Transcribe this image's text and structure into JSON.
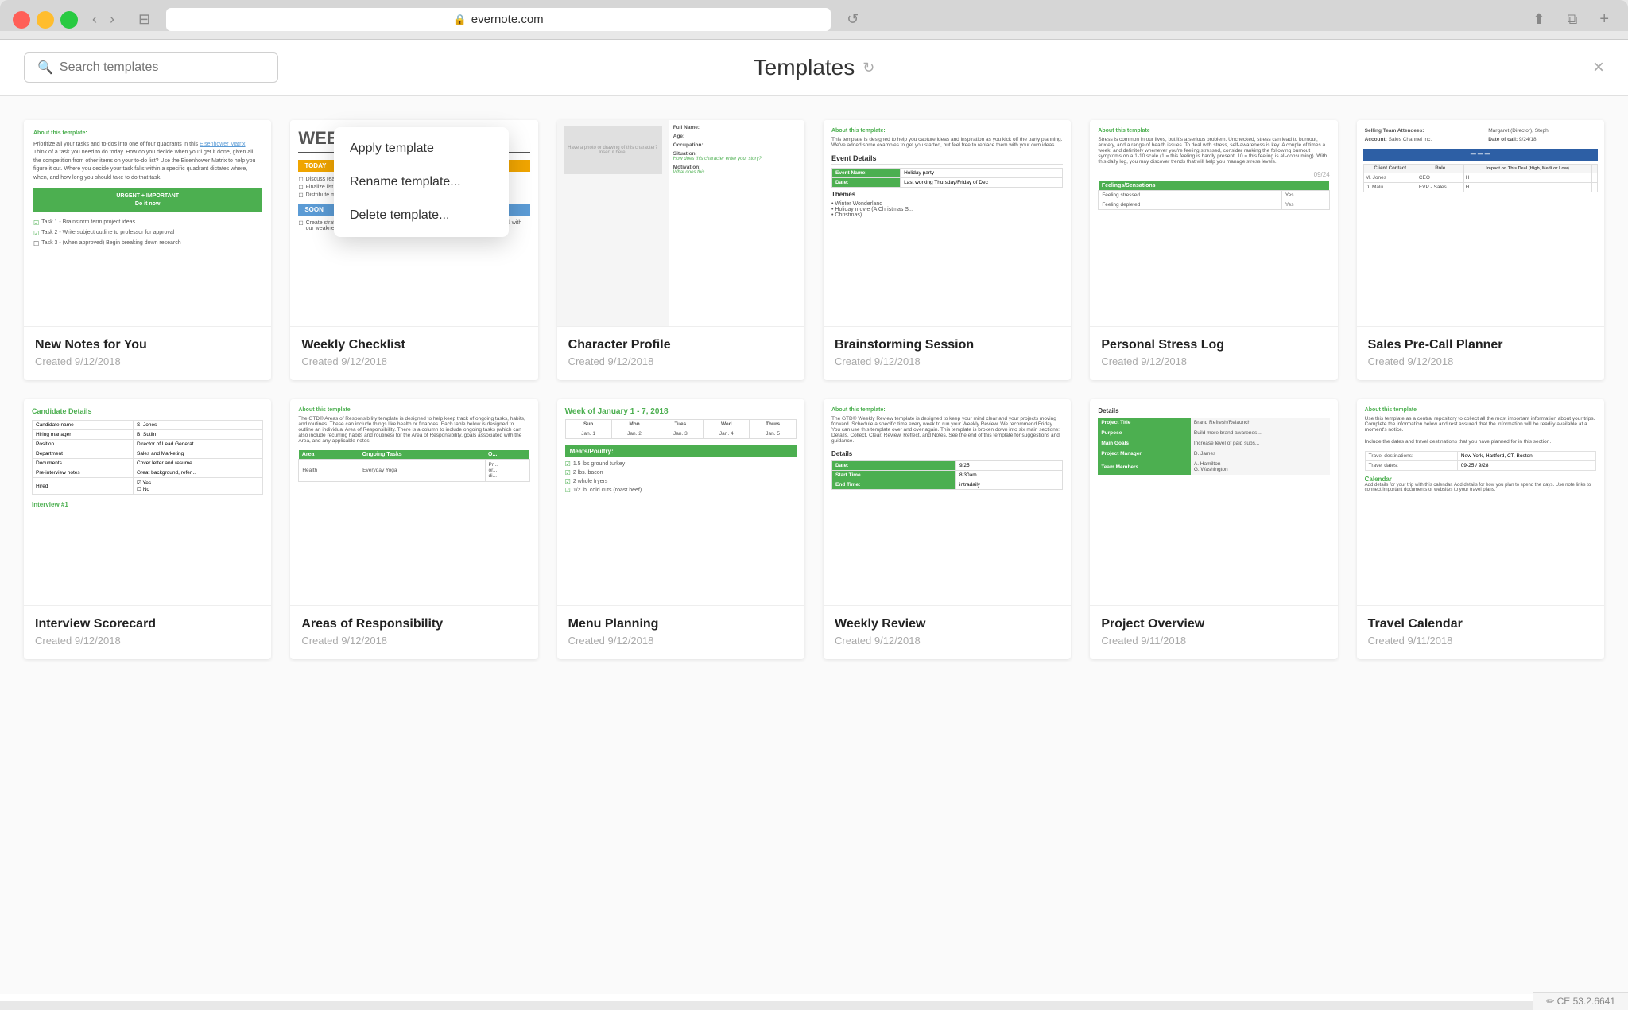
{
  "browser": {
    "url": "evernote.com",
    "traffic_lights": [
      "red",
      "yellow",
      "green"
    ]
  },
  "header": {
    "search_placeholder": "Search templates",
    "title": "Templates",
    "close_label": "×"
  },
  "context_menu": {
    "items": [
      {
        "label": "Apply template",
        "id": "apply"
      },
      {
        "label": "Rename template...",
        "id": "rename"
      },
      {
        "label": "Delete template...",
        "id": "delete"
      }
    ]
  },
  "templates_row1": [
    {
      "id": "new-notes",
      "title": "New Notes for You",
      "date": "Created 9/12/2018"
    },
    {
      "id": "weekly-checklist",
      "title": "Weekly Checklist",
      "date": "Created 9/12/2018"
    },
    {
      "id": "character-profile",
      "title": "Character Profile",
      "date": "Created 9/12/2018"
    },
    {
      "id": "brainstorming-session",
      "title": "Brainstorming Session",
      "date": "Created 9/12/2018"
    },
    {
      "id": "personal-stress-log",
      "title": "Personal Stress Log",
      "date": "Created 9/12/2018"
    },
    {
      "id": "sales-pre-call",
      "title": "Sales Pre-Call Planner",
      "date": "Created 9/12/2018"
    }
  ],
  "templates_row2": [
    {
      "id": "interview-scorecard",
      "title": "Interview Scorecard",
      "date": "Created 9/12/2018"
    },
    {
      "id": "areas-of-responsibility",
      "title": "Areas of Responsibility",
      "date": "Created 9/12/2018"
    },
    {
      "id": "menu-planning",
      "title": "Menu Planning",
      "date": "Created 9/12/2018"
    },
    {
      "id": "weekly-review",
      "title": "Weekly Review",
      "date": "Created 9/12/2018"
    },
    {
      "id": "project-overview",
      "title": "Project Overview",
      "date": "Created 9/11/2018"
    },
    {
      "id": "travel-calendar",
      "title": "Travel Calendar",
      "date": "Created 9/11/2018"
    }
  ],
  "status_bar": {
    "text": "CE 53.2.6641",
    "icon": "✏"
  }
}
